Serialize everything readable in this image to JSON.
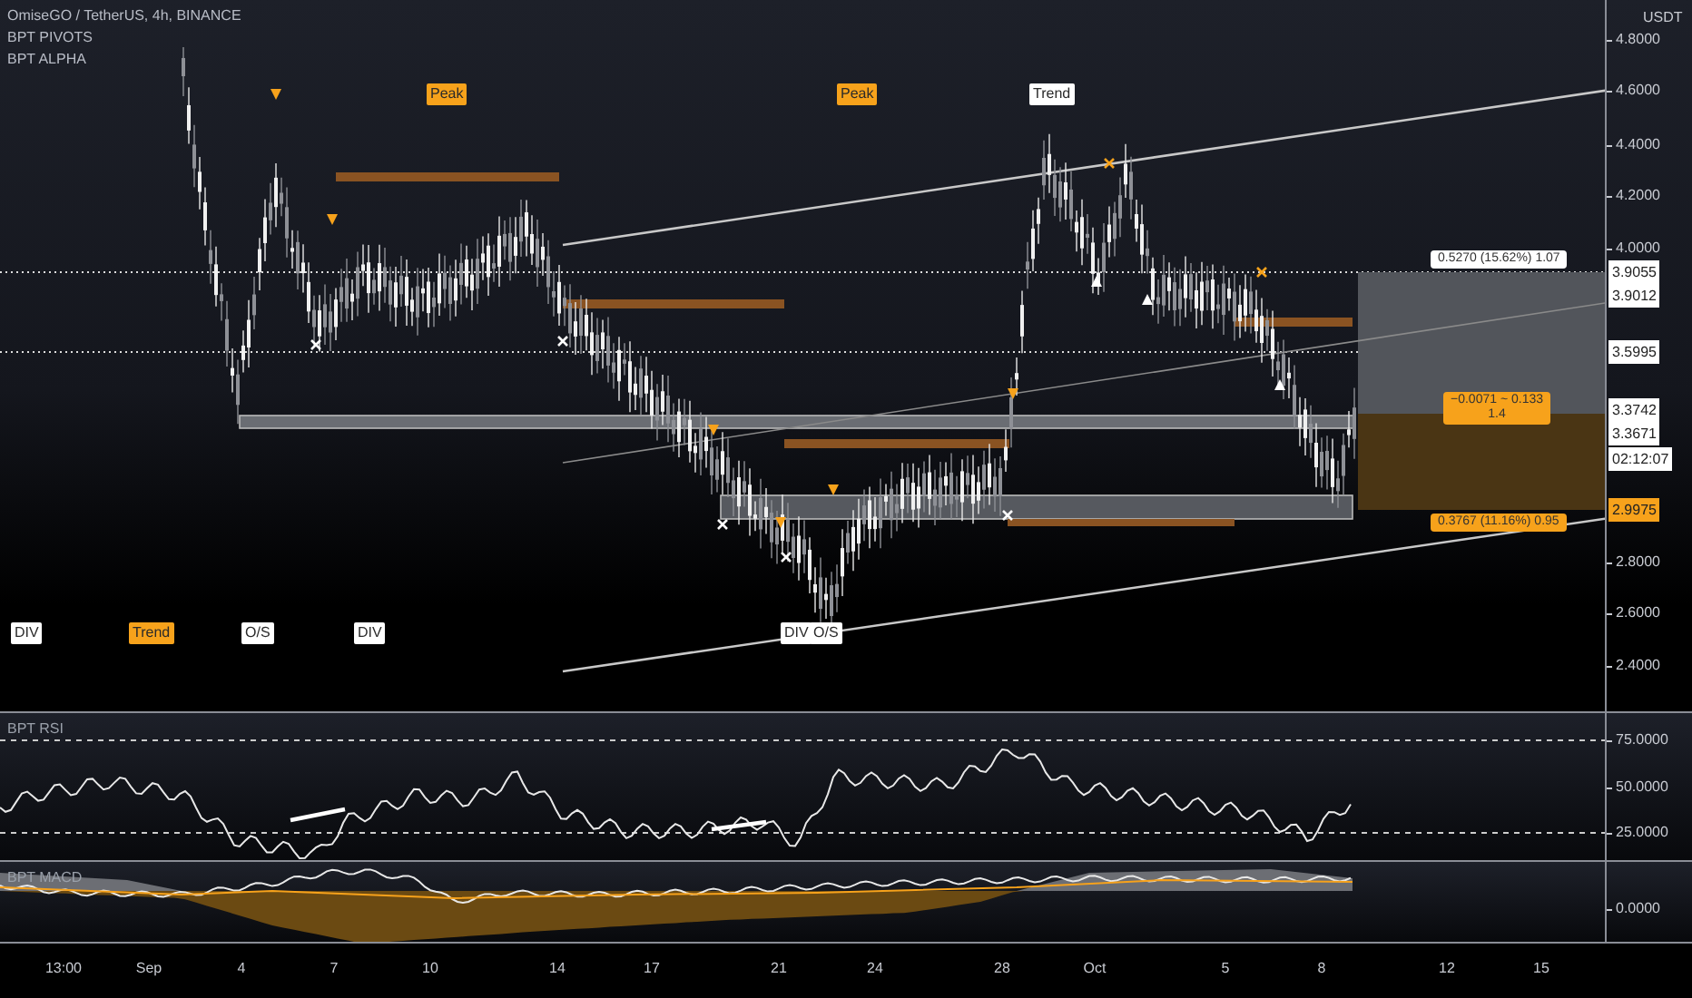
{
  "legend": {
    "symbol": "OmiseGO / TetherUS, 4h, BINANCE",
    "indicators": [
      "BPT PIVOTS",
      "BPT ALPHA"
    ]
  },
  "price_axis": {
    "unit": "USDT",
    "ticks": [
      "4.8000",
      "4.6000",
      "4.4000",
      "4.2000",
      "4.0000",
      "2.8000",
      "2.6000",
      "2.4000"
    ]
  },
  "price_tags": [
    {
      "text": "3.9055",
      "kind": "plain"
    },
    {
      "text": "3.9012",
      "kind": "plain"
    },
    {
      "text": "3.5995",
      "kind": "plain"
    },
    {
      "text": "3.3742",
      "kind": "plain"
    },
    {
      "text": "3.3671",
      "kind": "plain"
    },
    {
      "text": "02:12:07",
      "kind": "plain"
    },
    {
      "text": "2.9975",
      "kind": "last"
    }
  ],
  "signals_top": [
    {
      "text": "Peak",
      "color": "#f7a21b"
    },
    {
      "text": "Peak",
      "color": "#f7a21b"
    },
    {
      "text": "Trend",
      "color": "#ffffff"
    }
  ],
  "signals_bottom": [
    {
      "text": "DIV",
      "color": "#ffffff"
    },
    {
      "text": "Trend",
      "color": "#f7a21b"
    },
    {
      "text": "O/S",
      "color": "#ffffff"
    },
    {
      "text": "DIV",
      "color": "#ffffff"
    },
    {
      "text": "DIV",
      "color": "#ffffff"
    },
    {
      "text": "O/S",
      "color": "#ffffff"
    }
  ],
  "measure_labels": [
    {
      "lines": [
        "0.5270 (15.62%) 1.07"
      ],
      "color": "#ffffff"
    },
    {
      "lines": [
        "−0.0071 ~ 0.133",
        "1.4"
      ],
      "color": "#f7a21b"
    },
    {
      "lines": [
        "0.3767 (11.16%) 0.95"
      ],
      "color": "#f7a21b"
    }
  ],
  "rsi": {
    "title": "BPT RSI",
    "ticks": [
      "75.0000",
      "50.0000",
      "25.0000"
    ]
  },
  "macd": {
    "title": "BPT MACD",
    "ticks": [
      "0.0000"
    ]
  },
  "time_axis": [
    "13:00",
    "Sep",
    "4",
    "7",
    "10",
    "14",
    "17",
    "21",
    "24",
    "28",
    "Oct",
    "5",
    "8",
    "12",
    "15"
  ]
}
